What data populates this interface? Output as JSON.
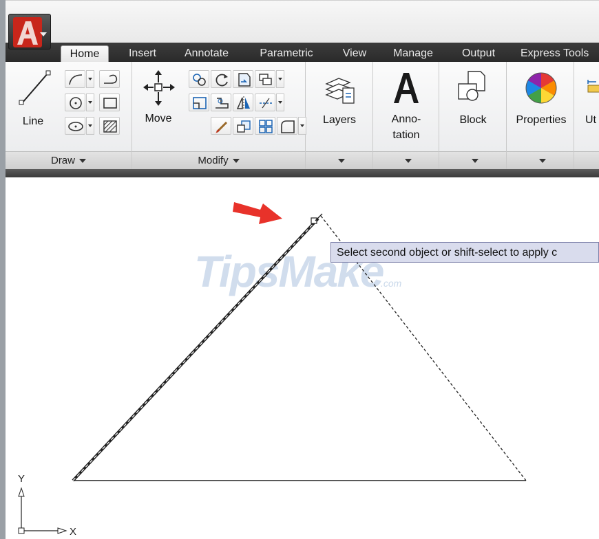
{
  "app": {
    "logo_letter": "A",
    "brand_color": "#c8261b"
  },
  "tabs": [
    {
      "label": "Home",
      "active": true
    },
    {
      "label": "Insert",
      "active": false
    },
    {
      "label": "Annotate",
      "active": false
    },
    {
      "label": "Parametric",
      "active": false
    },
    {
      "label": "View",
      "active": false
    },
    {
      "label": "Manage",
      "active": false
    },
    {
      "label": "Output",
      "active": false
    },
    {
      "label": "Express Tools",
      "active": false
    }
  ],
  "ribbon": {
    "draw": {
      "footer_label": "Draw",
      "line_label": "Line",
      "tools": [
        "polyline-icon",
        "circle-icon",
        "ellipse-icon",
        "arc-spline-icon",
        "rectangle-icon",
        "hatch-icon"
      ]
    },
    "modify": {
      "footer_label": "Modify",
      "move_label": "Move",
      "tools": [
        "copy-icon",
        "rotate-icon",
        "trim-icon",
        "array-icon",
        "stretch-icon",
        "mirror-icon",
        "erase-icon",
        "fillet-icon",
        "scale-icon",
        "explode-icon",
        "offset-icon",
        "chamfer-icon"
      ]
    },
    "layers_label": "Layers",
    "annotation_label_line1": "Anno-",
    "annotation_label_line2": "tation",
    "block_label": "Block",
    "properties_label": "Properties",
    "utilities_label": "Ut"
  },
  "canvas": {
    "tooltip": "Select second object or shift-select to apply c",
    "watermark": "TipsMake",
    "watermark_suffix": ".com",
    "ucs_y": "Y",
    "ucs_x": "X",
    "arrow_color": "#e8322a",
    "tooltip_bg": "#d9dced"
  }
}
